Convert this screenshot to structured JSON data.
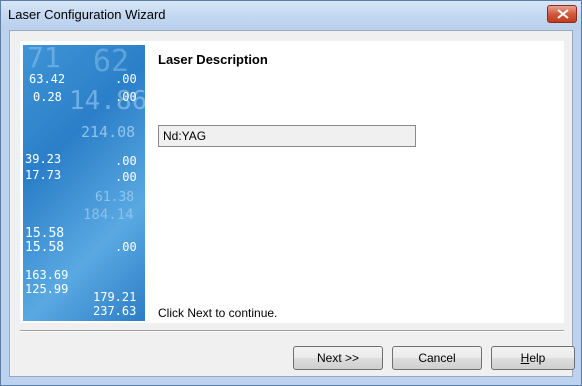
{
  "window": {
    "title": "Laser Configuration Wizard"
  },
  "page": {
    "heading": "Laser Description",
    "description_value": "Nd:YAG",
    "hint": "Click Next to continue."
  },
  "buttons": {
    "next": "Next >>",
    "cancel": "Cancel",
    "help_first": "H",
    "help_rest": "elp"
  },
  "sidebar_art": {
    "numbers": [
      "71",
      "62",
      "63.42",
      ".00",
      "0.28",
      "14.86",
      ".00",
      "214.08",
      "39.23",
      ".00",
      "17.73",
      ".00",
      "61.38",
      "184.14",
      "15.58",
      "15.58",
      ".00",
      "163.69",
      "125.99",
      "179.21",
      "237.63"
    ]
  },
  "colors": {
    "close_button": "#c94a2d",
    "sidebar_blue": "#2f86cf",
    "titlebar": "#c8dcf2"
  },
  "icons": {
    "close": "close-icon"
  }
}
